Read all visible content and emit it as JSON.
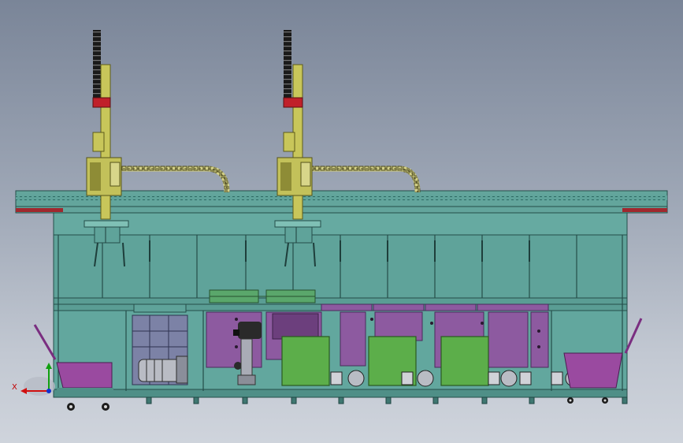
{
  "viewport": {
    "background": "cad-gradient-gray-blue"
  },
  "triad": {
    "x_label": "X",
    "colors": {
      "x": "#d01010",
      "y": "#10a010",
      "z": "#1030d0"
    }
  },
  "machine": {
    "components": [
      "top-gantry-beam",
      "robot-arm-left",
      "robot-arm-right",
      "cable-chain-left",
      "cable-chain-right",
      "main-frame",
      "process-tanks",
      "control-boxes",
      "vertical-pump",
      "pump-motor",
      "centrifugal-pumps",
      "waste-bins",
      "caster-wheels"
    ],
    "colors": {
      "frame": "#5fa39a",
      "frame_dark": "#2f6a64",
      "arm": "#c8c65a",
      "arm_dark": "#6f6d22",
      "accent_red": "#c0202a",
      "tank": "#8d5aa0",
      "tank_dark": "#5e3672",
      "control_box": "#5cae4a",
      "bin": "#9a4aa0",
      "pump": "#b9bcc4"
    }
  }
}
